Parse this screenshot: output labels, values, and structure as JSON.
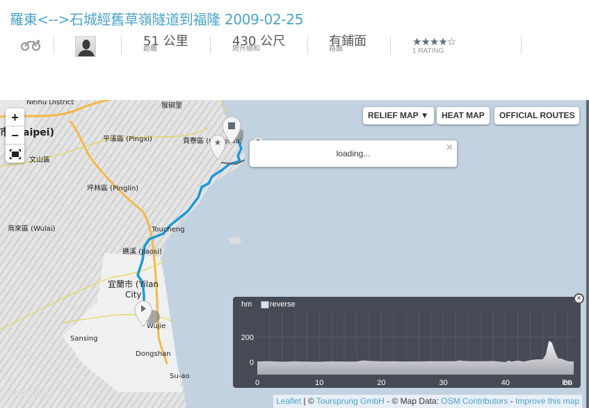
{
  "header": {
    "title": "羅東<-->石城經舊草嶺隧道到福隆 2009-02-25",
    "activity_icon": "bike-icon",
    "avatar_icon": "user-silhouette-icon",
    "stats": [
      {
        "value": "51",
        "unit": "公里",
        "label": "距離"
      },
      {
        "value": "430",
        "unit": "公尺",
        "label": "爬升總和"
      },
      {
        "value": "",
        "unit": "有鋪面",
        "label": "路面"
      }
    ],
    "rating": {
      "stars": 4,
      "max": 5,
      "label": "1 RATING",
      "stars_text": "★★★★☆"
    }
  },
  "map": {
    "zoom_in": "+",
    "zoom_out": "−",
    "fullscreen_icon": "fullscreen-icon",
    "buttons": {
      "relief": "RELIEF MAP ▼",
      "heat": "HEAT MAP",
      "official": "OFFICIAL ROUTES"
    },
    "popup": {
      "text": "loading...",
      "close": "×"
    },
    "labels": [
      {
        "text": "Neihu District"
      },
      {
        "text": "猴硐里"
      },
      {
        "text": "市 (Taipei)"
      },
      {
        "text": "平溪區 (Pingxi)"
      },
      {
        "text": "貢寮區 (Gongliao)"
      },
      {
        "text": "文山區"
      },
      {
        "text": "坪林區 (Pinglin)"
      },
      {
        "text": "烏來區 (Wulai)"
      },
      {
        "text": "Toucheng"
      },
      {
        "text": "礁溪 (Jiaosi)"
      },
      {
        "text": "宜蘭市 (Yilan"
      },
      {
        "text": "City"
      },
      {
        "text": "Wujie"
      },
      {
        "text": "Sansing"
      },
      {
        "text": "Dongshan"
      },
      {
        "text": "Su-ao"
      }
    ],
    "watermark": "Maptoolkit",
    "route_color": "#1a9ad6",
    "attribution": {
      "leaflet": "Leaflet",
      "sep1": " | © ",
      "toursprung": "Toursprung GmbH",
      "sep2": " - © Map Data: ",
      "osm": "OSM Contributors",
      "sep3": " - ",
      "improve": "Improve this map"
    }
  },
  "elevation": {
    "y_unit": "hm",
    "reverse_label": "reverse",
    "reverse_checked": false,
    "close": "×",
    "chart_data": {
      "type": "area",
      "title": "",
      "xlabel": "km",
      "ylabel": "hm",
      "xlim": [
        0,
        51
      ],
      "ylim": [
        -100,
        400
      ],
      "x_ticks": [
        "0",
        "10",
        "20",
        "30",
        "40",
        "50"
      ],
      "y_ticks": [
        "0",
        "200"
      ],
      "x_unit_label": "km",
      "x": [
        0,
        2,
        4,
        6,
        8,
        10,
        12,
        14,
        16,
        17,
        18,
        20,
        22,
        24,
        26,
        28,
        30,
        32,
        32.5,
        34,
        36,
        38,
        40,
        40.5,
        41,
        42,
        43,
        44,
        45,
        46,
        46.5,
        47,
        47.5,
        48,
        48.5,
        49,
        50,
        51
      ],
      "values": [
        5,
        8,
        3,
        6,
        4,
        3,
        6,
        5,
        4,
        14,
        10,
        6,
        7,
        5,
        6,
        8,
        7,
        8,
        14,
        8,
        7,
        9,
        0,
        12,
        5,
        12,
        4,
        16,
        22,
        22,
        60,
        170,
        155,
        80,
        30,
        28,
        8,
        5
      ]
    }
  }
}
